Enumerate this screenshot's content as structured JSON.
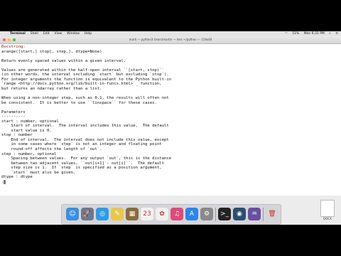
{
  "menubar": {
    "apple": "",
    "items": [
      "Terminal",
      "Shell",
      "Edit",
      "View",
      "Window",
      "Help"
    ],
    "battery": "51%",
    "clock": "Mon 6:31 PM"
  },
  "window": {
    "title": "marti — python3 Users/martin — less ~/python — 118x40"
  },
  "terminal": {
    "lines": [
      {
        "text": "Docstring:",
        "cls": "hdr"
      },
      {
        "text": "arange([start,] stop[, step,], dtype=None)"
      },
      {
        "text": ""
      },
      {
        "text": "Return evenly spaced values within a given interval."
      },
      {
        "text": ""
      },
      {
        "text": "Values are generated within the half-open interval ``[start, stop)``"
      },
      {
        "text": "(in other words, the interval including `start` but excluding `stop`)."
      },
      {
        "text": "For integer arguments the function is equivalent to the Python built-in"
      },
      {
        "text": "`range <http://docs.python.org/lib/built-in-funcs.html>`_ function,"
      },
      {
        "text": "but returns an ndarray rather than a list."
      },
      {
        "text": ""
      },
      {
        "text": "When using a non-integer step, such as 0.1, the results will often not"
      },
      {
        "text": "be consistent.  It is better to use ``linspace`` for these cases."
      },
      {
        "text": ""
      },
      {
        "text": "Parameters"
      },
      {
        "text": "----------"
      },
      {
        "text": "start : number, optional"
      },
      {
        "text": "    Start of interval.  The interval includes this value.  The default"
      },
      {
        "text": "    start value is 0."
      },
      {
        "text": "stop : number"
      },
      {
        "text": "    End of interval.  The interval does not include this value, except"
      },
      {
        "text": "    in some cases where `step` is not an integer and floating point"
      },
      {
        "text": "    round-off affects the length of `out`."
      },
      {
        "text": "step : number, optional"
      },
      {
        "text": "    Spacing between values.  For any output `out`, this is the distance"
      },
      {
        "text": "    between two adjacent values, ``out[i+1] - out[i]``.  The default"
      },
      {
        "text": "    step size is 1.  If `step` is specified as a position argument,"
      },
      {
        "text": "    `start` must also be given."
      },
      {
        "text": "dtype : dtype"
      },
      {
        "text": ":"
      }
    ]
  },
  "dock": {
    "items": [
      {
        "name": "finder-icon",
        "color": "#3b8fe0",
        "glyph": "☺"
      },
      {
        "name": "launchpad-icon",
        "color": "#6c7a8c",
        "glyph": "🚀"
      },
      {
        "name": "safari-icon",
        "color": "#2f9be6",
        "glyph": "◎"
      },
      {
        "name": "notes-icon",
        "color": "#e8c84a",
        "glyph": "✎"
      },
      {
        "name": "photos-app-icon",
        "color": "#8c6b3d",
        "glyph": "▦"
      },
      {
        "name": "calendar-icon",
        "color": "#f2f2f2",
        "glyph": "23"
      },
      {
        "name": "photos-icon",
        "color": "#f0f0f0",
        "glyph": "✿"
      },
      {
        "name": "itunes-icon",
        "color": "#e04a7a",
        "glyph": "♫"
      },
      {
        "name": "app-store-icon",
        "color": "#2a86e8",
        "glyph": "A"
      },
      {
        "name": "system-preferences-icon",
        "color": "#8a8a8a",
        "glyph": "⚙"
      },
      {
        "name": "terminal-icon",
        "color": "#222222",
        "glyph": ">_"
      },
      {
        "name": "quicktime-icon",
        "color": "#2b4d6e",
        "glyph": "◉"
      },
      {
        "name": "instruments-icon",
        "color": "#6a4fa0",
        "glyph": "♒"
      },
      {
        "name": "trash-icon",
        "color": "#d5d5d8",
        "glyph": "🗑"
      }
    ]
  },
  "desktop_file": {
    "label": "DOCX"
  }
}
